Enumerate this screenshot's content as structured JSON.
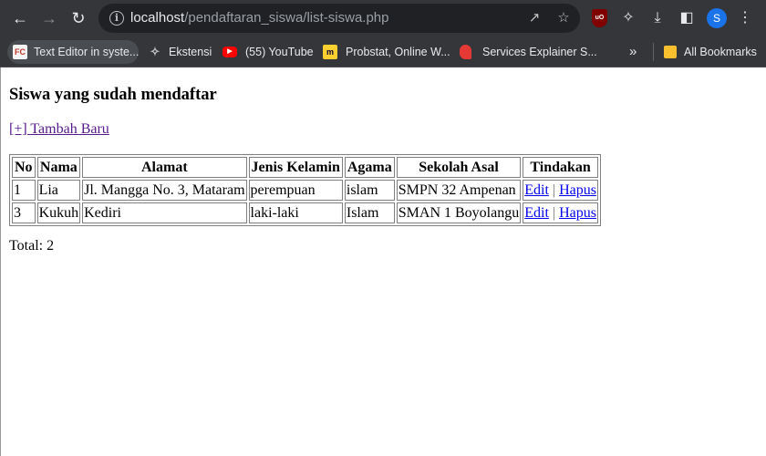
{
  "browser": {
    "url_host": "localhost",
    "url_path": "/pendaftaran_siswa/list-siswa.php",
    "profile_initial": "S",
    "bookmarks": [
      {
        "label": "Text Editor in syste...",
        "icon": "fc-icon",
        "icon_text": "FC"
      },
      {
        "label": "Ekstensi",
        "icon": "puzzle-icon"
      },
      {
        "label": "(55) YouTube",
        "icon": "youtube-icon"
      },
      {
        "label": "Probstat, Online W...",
        "icon": "miro-icon"
      },
      {
        "label": "Services Explainer S...",
        "icon": "bookmark-red-icon"
      }
    ],
    "overflow": "»",
    "all_bookmarks": "All Bookmarks"
  },
  "page": {
    "title": "Siswa yang sudah mendaftar",
    "add_link": "[+] Tambah Baru",
    "table": {
      "headers": [
        "No",
        "Nama",
        "Alamat",
        "Jenis Kelamin",
        "Agama",
        "Sekolah Asal",
        "Tindakan"
      ],
      "rows": [
        {
          "no": "1",
          "nama": "Lia",
          "alamat": "Jl. Mangga No. 3, Mataram",
          "jenis_kelamin": "perempuan",
          "agama": "islam",
          "sekolah_asal": "SMPN 32 Ampenan"
        },
        {
          "no": "3",
          "nama": "Kukuh",
          "alamat": "Kediri",
          "jenis_kelamin": "laki-laki",
          "agama": "Islam",
          "sekolah_asal": "SMAN 1 Boyolangu"
        }
      ],
      "edit_label": "Edit",
      "delete_label": "Hapus",
      "action_separator": "|"
    },
    "total": "Total: 2"
  }
}
